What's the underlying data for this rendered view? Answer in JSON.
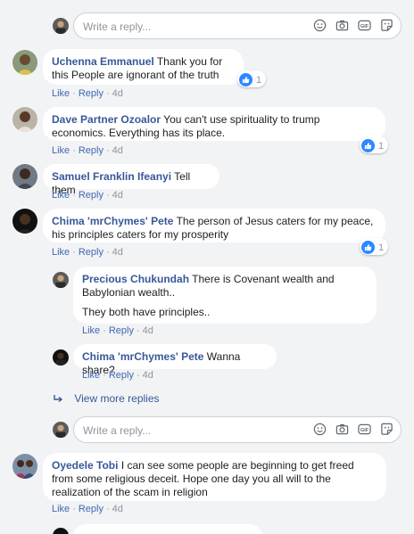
{
  "reply_box_top": {
    "placeholder": "Write a reply..."
  },
  "comments": [
    {
      "author": "Uchenna Emmanuel",
      "text": "Thank you for this People are ignorant of the truth",
      "like": "Like",
      "reply": "Reply",
      "time": "4d",
      "reactions": "1"
    },
    {
      "author": "Dave Partner Ozoalor",
      "text": "You can't use spirituality to trump economics. Everything has its place.",
      "like": "Like",
      "reply": "Reply",
      "time": "4d",
      "reactions": "1"
    },
    {
      "author": "Samuel Franklin Ifeanyi",
      "text": "Tell them",
      "like": "Like",
      "reply": "Reply",
      "time": "4d"
    },
    {
      "author": "Chima 'mrChymes' Pete",
      "text": "The person of Jesus caters for my peace, his principles caters for my prosperity",
      "like": "Like",
      "reply": "Reply",
      "time": "4d",
      "reactions": "1"
    }
  ],
  "replies": [
    {
      "author": "Precious Chukundah",
      "text": "There is Covenant wealth and Babylonian wealth..",
      "text2": "They both have principles..",
      "like": "Like",
      "reply": "Reply",
      "time": "4d"
    },
    {
      "author": "Chima 'mrChymes' Pete",
      "text": "Wanna share?",
      "like": "Like",
      "reply": "Reply",
      "time": "4d"
    }
  ],
  "view_more": "View more replies",
  "reply_box_bottom": {
    "placeholder": "Write a reply..."
  },
  "last_comment": {
    "author": "Oyedele Tobi",
    "text": "I can see some people are beginning to get freed from some religious deceit. Hope one day you all will to the realization of the scam in religion",
    "like": "Like",
    "reply": "Reply",
    "time": "4d"
  },
  "icons": {
    "emoji": "emoji-icon",
    "camera": "camera-icon",
    "gif": "gif-icon",
    "sticker": "sticker-icon",
    "like_reaction": "like-reaction-icon",
    "reply_arrow": "reply-arrow-icon"
  },
  "colors": {
    "link": "#385898",
    "action": "#4267b2",
    "muted": "#90949c",
    "background": "#f2f3f5",
    "like_blue": "#2d88ff"
  }
}
